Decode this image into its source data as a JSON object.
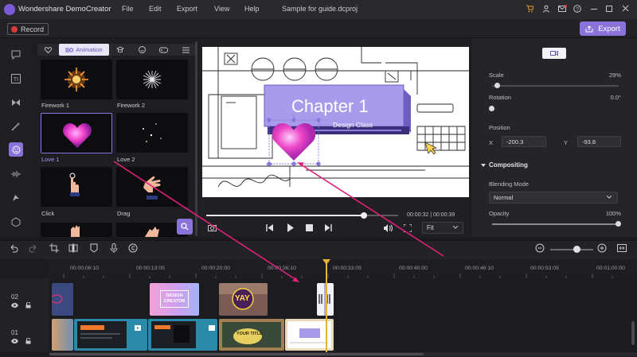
{
  "app": {
    "title": "Wondershare DemoCreator",
    "file": "Sample for guide.dcproj"
  },
  "menu": [
    "File",
    "Edit",
    "Export",
    "View",
    "Help"
  ],
  "record_label": "Record",
  "export_label": "Export",
  "library": {
    "tabs": [
      {
        "icon": "heart-icon"
      },
      {
        "icon": "animation-icon",
        "label": "Animation"
      },
      {
        "icon": "hat-icon"
      },
      {
        "icon": "smile-icon"
      },
      {
        "icon": "gamepad-icon"
      },
      {
        "icon": "list-icon"
      }
    ],
    "items": [
      "Firework 1",
      "Firework 2",
      "Love 1",
      "Love 2",
      "Click",
      "Drag"
    ]
  },
  "canvas": {
    "title": "Chapter 1",
    "subtitle": "Design Class"
  },
  "player": {
    "time": "00:00:32 | 00:00:39",
    "fit": "Fit",
    "progress": 0.82
  },
  "properties": {
    "scale_label": "Scale",
    "scale_value": "29%",
    "scale_fraction": 0.04,
    "rotation_label": "Rotation",
    "rotation_value": "0.0°",
    "position_label": "Position",
    "x_label": "X",
    "x_value": "-200.3",
    "y_label": "Y",
    "y_value": "-93.8",
    "compositing_label": "Compositing",
    "blending_label": "Blending Mode",
    "blending_value": "Normal",
    "opacity_label": "Opacity",
    "opacity_value": "100%"
  },
  "timeline": {
    "ticks": [
      "00:00:06:10",
      "00:00:13:05",
      "00:00:20:00",
      "00:00:26:10",
      "00:00:33:05",
      "00:00:40:00",
      "00:00:46:10",
      "00:00:53:05",
      "00:01:00:00"
    ],
    "tracks": [
      "02",
      "01"
    ],
    "clip_design": "DESIGN CREATOR",
    "clip_yay": "YAY",
    "clip_your": "YOUR TITLE"
  },
  "colors": {
    "accent": "#8a74d9",
    "arrow": "#e0207a",
    "playhead": "#e6b23a"
  }
}
